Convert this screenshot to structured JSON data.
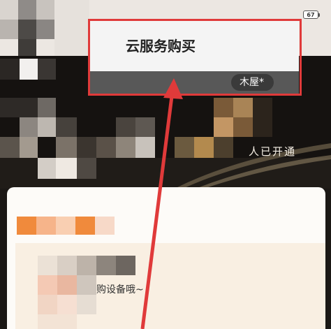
{
  "status_bar": {
    "battery_level": "67"
  },
  "menu": {
    "cloud_service_label": "云服务购买",
    "store_label": "木屋*"
  },
  "banner": {
    "opened_text": "人已开通"
  },
  "panel": {
    "hint_text": "购设备哦~"
  },
  "colors": {
    "highlight": "#e03a3a",
    "panel_bg": "#fdfbf8",
    "panel_inner_bg": "#f9efe2",
    "orange_accent": "#f08a3c"
  },
  "icons": [
    "battery-icon",
    "arrow-icon"
  ]
}
